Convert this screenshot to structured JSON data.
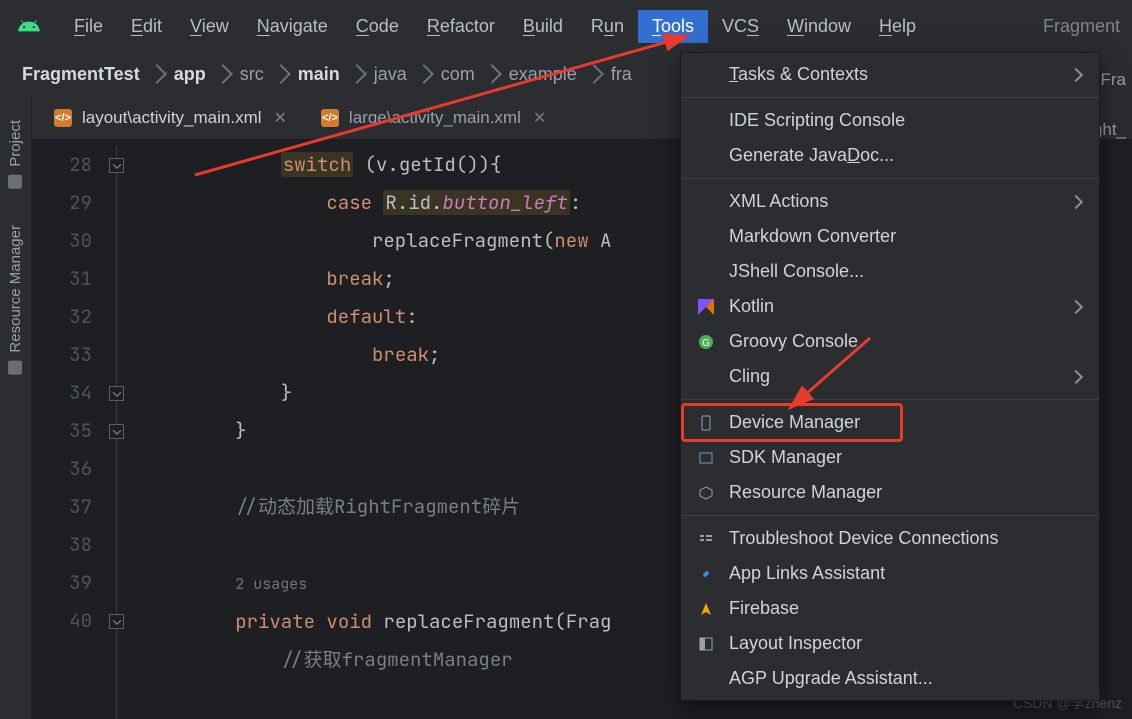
{
  "menubar": {
    "items": [
      {
        "html": "<u>F</u>ile"
      },
      {
        "html": "<u>E</u>dit"
      },
      {
        "html": "<u>V</u>iew"
      },
      {
        "html": "<u>N</u>avigate"
      },
      {
        "html": "<u>C</u>ode"
      },
      {
        "html": "<u>R</u>efactor"
      },
      {
        "html": "<u>B</u>uild"
      },
      {
        "html": "R<u>u</u>n"
      },
      {
        "html": "<u>T</u>ools",
        "active": true
      },
      {
        "html": "VC<u>S</u>"
      },
      {
        "html": "<u>W</u>indow"
      },
      {
        "html": "<u>H</u>elp"
      }
    ],
    "right_label": "Fragment"
  },
  "breadcrumb": {
    "items": [
      {
        "text": "FragmentTest",
        "bold": true
      },
      {
        "text": "app",
        "bold": true
      },
      {
        "text": "src"
      },
      {
        "text": "main",
        "bold": true
      },
      {
        "text": "java"
      },
      {
        "text": "com"
      },
      {
        "text": "example"
      },
      {
        "text": "fra"
      }
    ]
  },
  "side_tools": {
    "project": "Project",
    "resmgr": "Resource Manager"
  },
  "tabs": {
    "items": [
      {
        "label": "layout\\activity_main.xml"
      },
      {
        "label": "large\\activity_main.xml"
      }
    ]
  },
  "editor": {
    "lines": [
      {
        "n": 28,
        "html": "            <span class='kw-hl'>switch</span> (v.getId()){"
      },
      {
        "n": 29,
        "html": "                <span class='kw'>case</span> <span class='id-hl'>R.id.<span class='field'>button_left</span></span>:"
      },
      {
        "n": 30,
        "html": "                    replaceFragment(<span class='kw'>new</span> A"
      },
      {
        "n": 31,
        "html": "                <span class='kw'>break</span>;"
      },
      {
        "n": 32,
        "html": "                <span class='kw'>default</span>:"
      },
      {
        "n": 33,
        "html": "                    <span class='kw'>break</span>;"
      },
      {
        "n": 34,
        "html": "            }"
      },
      {
        "n": 35,
        "html": "        }"
      },
      {
        "n": 36,
        "html": ""
      },
      {
        "n": 37,
        "html": "        <span class='comment'>//动态加载RightFragment碎片</span>"
      },
      {
        "n": 38,
        "html": ""
      },
      {
        "n": "",
        "html": "        <span class='hint'>2 usages</span>"
      },
      {
        "n": 39,
        "html": "        <span class='kw'>private</span> <span class='kw'>void</span> replaceFragment(Frag"
      },
      {
        "n": 40,
        "html": "            <span class='comment'>//获取fragmentManager</span>"
      }
    ]
  },
  "tools_menu": {
    "groups": [
      {
        "items": [
          {
            "label": "Tasks & Contexts",
            "sub": true,
            "underline_index": 0
          }
        ]
      },
      {
        "items": [
          {
            "label": "IDE Scripting Console"
          },
          {
            "label": "Generate JavaDoc...",
            "underline_index": 13
          }
        ]
      },
      {
        "items": [
          {
            "label": "XML Actions",
            "sub": true
          },
          {
            "label": "Markdown Converter"
          },
          {
            "label": "JShell Console..."
          },
          {
            "label": "Kotlin",
            "sub": true,
            "icon": "kotlin"
          },
          {
            "label": "Groovy Console",
            "icon": "groovy"
          },
          {
            "label": "Cling",
            "sub": true
          }
        ]
      },
      {
        "items": [
          {
            "label": "Device Manager",
            "icon": "device",
            "highlight": true
          },
          {
            "label": "SDK Manager",
            "icon": "sdk"
          },
          {
            "label": "Resource Manager",
            "icon": "resource"
          }
        ]
      },
      {
        "items": [
          {
            "label": "Troubleshoot Device Connections",
            "icon": "troubleshoot"
          },
          {
            "label": "App Links Assistant",
            "icon": "link"
          },
          {
            "label": "Firebase",
            "icon": "firebase"
          },
          {
            "label": "Layout Inspector",
            "icon": "layout"
          },
          {
            "label": "AGP Upgrade Assistant..."
          }
        ]
      }
    ]
  },
  "right_strip": {
    "a": "eFra",
    "b": "ght_"
  },
  "watermark": "CSDN @李zhenz"
}
